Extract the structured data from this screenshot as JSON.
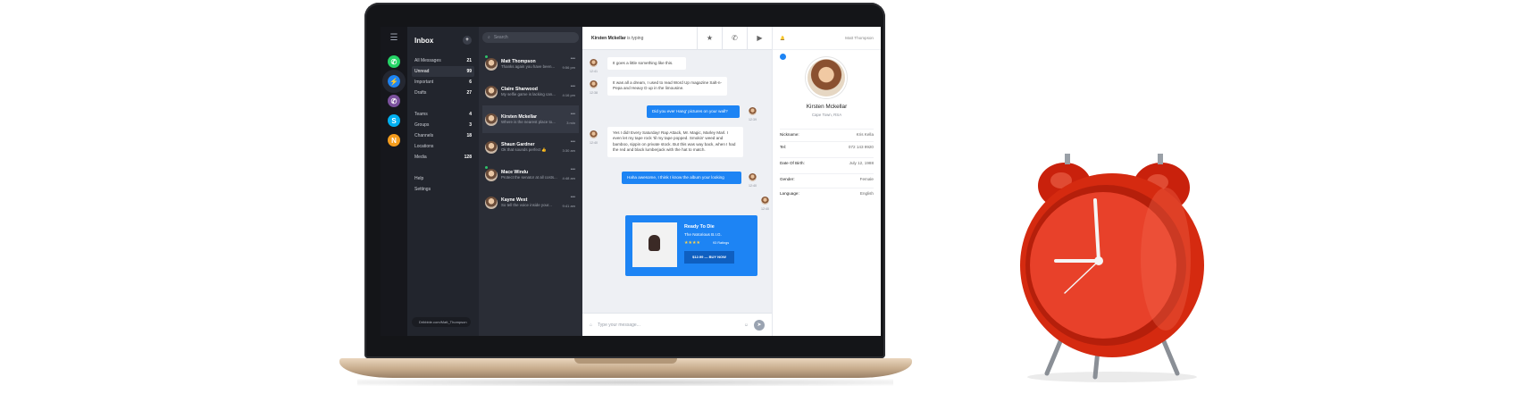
{
  "rail": {
    "menu_icon": "hamburger-icon",
    "apps": [
      {
        "name": "whatsapp",
        "color": "#25d366",
        "glyph": "✆"
      },
      {
        "name": "messenger",
        "color": "#1d84f4",
        "glyph": "⚡"
      },
      {
        "name": "viber",
        "color": "#7b519d",
        "glyph": "✆"
      },
      {
        "name": "skype",
        "color": "#00aff0",
        "glyph": "S"
      },
      {
        "name": "other",
        "color": "#f49c1d",
        "glyph": "N"
      }
    ]
  },
  "folders": {
    "title": "Inbox",
    "items": [
      {
        "label": "All Messages",
        "count": "21"
      },
      {
        "label": "Unread",
        "count": "99"
      },
      {
        "label": "Important",
        "count": "6"
      },
      {
        "label": "Drafts",
        "count": "27"
      }
    ],
    "items2": [
      {
        "label": "Teams",
        "count": "4"
      },
      {
        "label": "Groups",
        "count": "3"
      },
      {
        "label": "Channels",
        "count": "18"
      },
      {
        "label": "Locations",
        "count": ""
      },
      {
        "label": "Media",
        "count": "128"
      }
    ],
    "items3": [
      {
        "label": "Help"
      },
      {
        "label": "Settings"
      }
    ],
    "footer_user": "Dribbble.com/Matt_Thompson"
  },
  "search": {
    "placeholder": "Search"
  },
  "conversations": [
    {
      "name": "Matt Thompson",
      "preview": "Thanks again you have been...",
      "time": "9:56 pm"
    },
    {
      "name": "Claire Sharwood",
      "preview": "My selfie game is lacking can...",
      "time": "4:16 pm"
    },
    {
      "name": "Kirsten Mckellar",
      "preview": "Where is the nearest place to...",
      "time": "3 min"
    },
    {
      "name": "Shaun Gardner",
      "preview": "Ok that sounds perfect 👍",
      "time": "3:30 am"
    },
    {
      "name": "Mace Windu",
      "preview": "Protect the senator at all costs...",
      "time": "4:48 am"
    },
    {
      "name": "Kayne West",
      "preview": "So tell the voice inside your...",
      "time": "9:41 am"
    }
  ],
  "chat": {
    "typing_name": "Kirsten Mckellar",
    "typing_suffix": "is typing",
    "messages": [
      {
        "dir": "in",
        "text": "It goes a little something like this.",
        "time": "12:41"
      },
      {
        "dir": "in",
        "text": "It was all a dream, I used to read Word Up magazine Salt-n-Pepa and Heavy D up in the limousine.",
        "time": "12:38"
      },
      {
        "dir": "out",
        "text": "Did you ever Hang' pictures on your wall?",
        "time": "12:39"
      },
      {
        "dir": "in",
        "text": "Yes I did! Every Saturday! Rap Attack, Mr. Magic, Marley Marl. I even let my tape rock 'til my tape popped. Smokin' weed and bamboo, sippin on private stock. But this was way back, when I had the red and black lumberjack with the hat to match.",
        "time": "12:40"
      },
      {
        "dir": "out",
        "text": "Haha awesome, I think I know the album your looking",
        "time": "12:40"
      }
    ],
    "album": {
      "title": "Ready To Die",
      "artist": "The Notorious B.I.G.",
      "stars": "★★★★",
      "ratings": "93 Ratings",
      "buy": "$12.99 — BUY NOW",
      "time": "12:40"
    },
    "composer_placeholder": "Type your message..."
  },
  "profile": {
    "user": "Matt Thompson",
    "name": "Kirsten Mckellar",
    "location": "Cape Town, RSA",
    "fields": [
      {
        "k": "Nickname:",
        "v": "Kris Kella"
      },
      {
        "k": "Tel:",
        "v": "072 143 9920"
      },
      {
        "k": "Date Of Birth:",
        "v": "July 12, 1988"
      },
      {
        "k": "Gender:",
        "v": "Female"
      },
      {
        "k": "Language:",
        "v": "English"
      }
    ]
  }
}
